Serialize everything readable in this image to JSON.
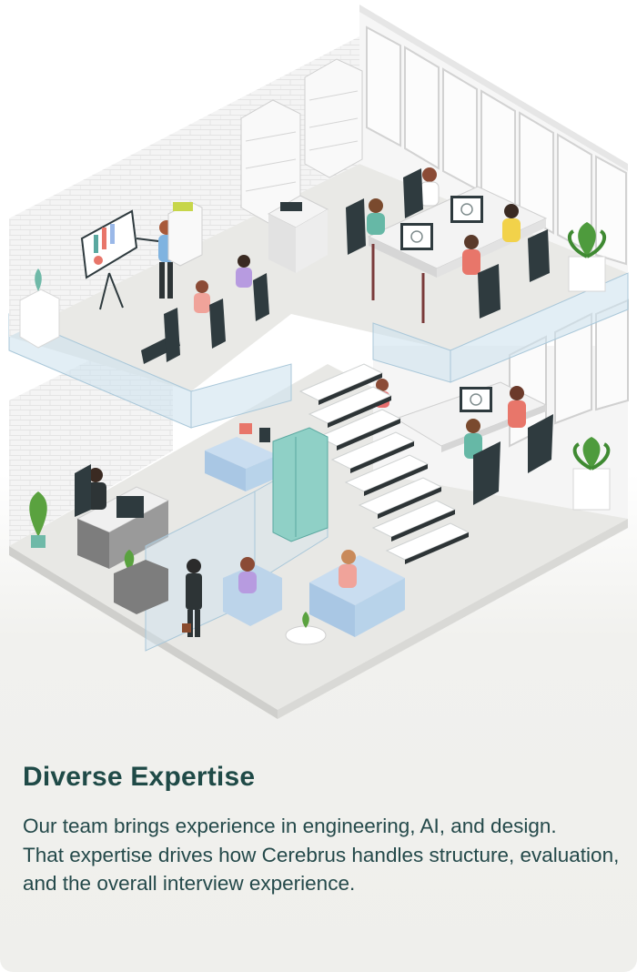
{
  "card": {
    "image_name": "isometric-office-illustration",
    "heading": "Diverse Expertise",
    "paragraphs": [
      "Our team brings experience in engineering, AI, and design.",
      "That expertise drives how Cerebrus handles structure, evaluation, and the overall interview experience."
    ]
  },
  "colors": {
    "heading": "#1f4a47",
    "text": "#24494a",
    "floor": "#e9e9e6",
    "wall": "#f3f3f3",
    "glass": "#c4dceb",
    "accent_teal": "#5aa8a0",
    "furniture_dark": "#2f3b3f"
  }
}
